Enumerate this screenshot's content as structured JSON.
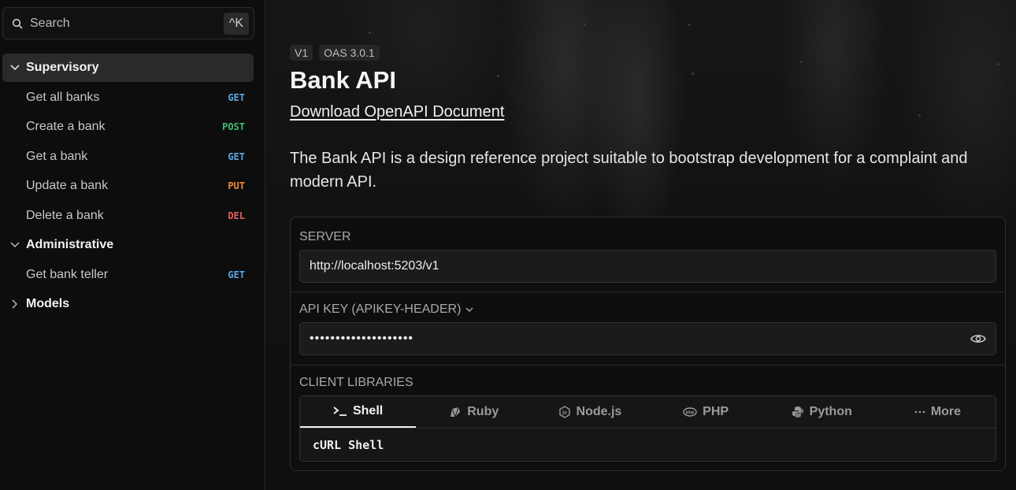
{
  "sidebar": {
    "search": {
      "placeholder": "Search",
      "shortcut": "^K"
    },
    "groups": [
      {
        "label": "Supervisory",
        "expanded": true,
        "active": true,
        "items": [
          {
            "label": "Get all banks",
            "method": "GET"
          },
          {
            "label": "Create a bank",
            "method": "POST"
          },
          {
            "label": "Get a bank",
            "method": "GET"
          },
          {
            "label": "Update a bank",
            "method": "PUT"
          },
          {
            "label": "Delete a bank",
            "method": "DEL"
          }
        ]
      },
      {
        "label": "Administrative",
        "expanded": true,
        "items": [
          {
            "label": "Get bank teller",
            "method": "GET"
          }
        ]
      },
      {
        "label": "Models",
        "expanded": false,
        "items": []
      }
    ]
  },
  "method_colors": {
    "GET": "#5aa7e6",
    "POST": "#3fbf6e",
    "PUT": "#f08a3c",
    "DEL": "#ea5a5a"
  },
  "header": {
    "version": "V1",
    "spec": "OAS 3.0.1",
    "title": "Bank API",
    "download_link": "Download OpenAPI Document",
    "description": "The Bank API is a design reference project suitable to bootstrap development for a complaint and modern API."
  },
  "config": {
    "server_label": "SERVER",
    "server_value": "http://localhost:5203/v1",
    "apikey_label": "API KEY (APIKEY-HEADER)",
    "apikey_value": "••••••••••••••••••••",
    "client_label": "CLIENT LIBRARIES",
    "tabs": [
      {
        "label": "Shell",
        "icon": "terminal-icon",
        "active": true
      },
      {
        "label": "Ruby",
        "icon": "ruby-icon",
        "active": false
      },
      {
        "label": "Node.js",
        "icon": "nodejs-icon",
        "active": false
      },
      {
        "label": "PHP",
        "icon": "php-icon",
        "active": false
      },
      {
        "label": "Python",
        "icon": "python-icon",
        "active": false
      },
      {
        "label": "More",
        "icon": "more-icon",
        "active": false
      }
    ],
    "selected_client": "cURL Shell"
  }
}
